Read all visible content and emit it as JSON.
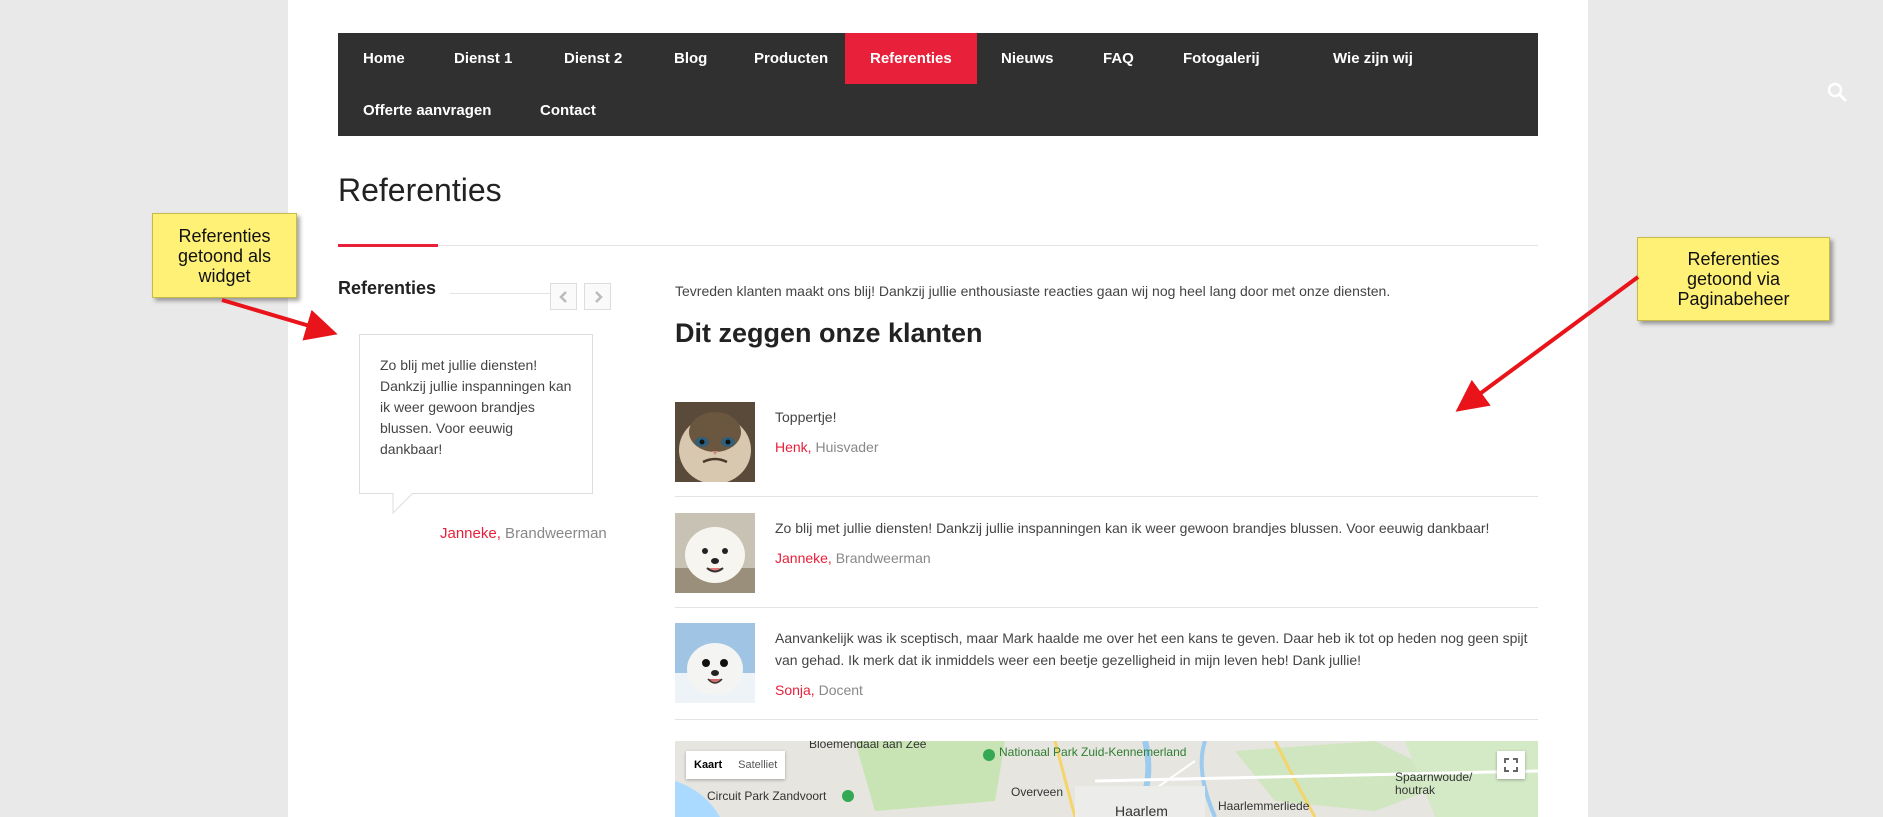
{
  "nav": {
    "row1": [
      "Home",
      "Dienst 1",
      "Dienst 2",
      "Blog",
      "Producten",
      "Referenties",
      "Nieuws",
      "FAQ",
      "Fotogalerij",
      "Wie zijn wij"
    ],
    "row2": [
      "Offerte aanvragen",
      "Contact"
    ],
    "active": "Referenties",
    "search_icon": "search-icon"
  },
  "page": {
    "title": "Referenties"
  },
  "widget": {
    "title": "Referenties",
    "prev_icon": "chevron-left-icon",
    "next_icon": "chevron-right-icon",
    "quote": "Zo blij met jullie diensten! Dankzij jullie inspanningen kan ik weer gewoon brandjes blussen. Voor eeuwig dankbaar!",
    "author_name": "Janneke,",
    "author_role": " Brandweerman"
  },
  "main": {
    "intro": "Tevreden klanten maakt ons blij! Dankzij jullie enthousiaste reacties gaan wij nog heel lang door met onze diensten.",
    "section_title": "Dit zeggen onze klanten",
    "testimonials": [
      {
        "text": "Toppertje!",
        "name": "Henk,",
        "role": " Huisvader"
      },
      {
        "text": "Zo blij met jullie diensten! Dankzij jullie inspanningen kan ik weer gewoon brandjes blussen. Voor eeuwig dankbaar!",
        "name": "Janneke,",
        "role": " Brandweerman"
      },
      {
        "text": "Aanvankelijk was ik sceptisch, maar Mark haalde me over het een kans te geven. Daar heb ik tot op heden nog geen spijt van gehad. Ik merk dat ik inmiddels weer een beetje gezelligheid in mijn leven heb! Dank jullie!",
        "name": "Sonja,",
        "role": " Docent"
      }
    ]
  },
  "map": {
    "btn_map": "Kaart",
    "btn_sat": "Satelliet",
    "labels": [
      "Bloemendaal aan Zee",
      "Nationaal Park Zuid-Kennemerland",
      "Circuit Park Zandvoort",
      "Overveen",
      "Haarlem",
      "Haarlemmerliede",
      "Spaarnwoude/ houtrak"
    ]
  },
  "callouts": {
    "left": "Referenties getoond als widget",
    "right": "Referenties getoond via Paginabeheer"
  },
  "colors": {
    "accent": "#e8203a",
    "nav_bg": "#303030",
    "callout_bg": "#fff176",
    "arrow": "#e8141a"
  }
}
